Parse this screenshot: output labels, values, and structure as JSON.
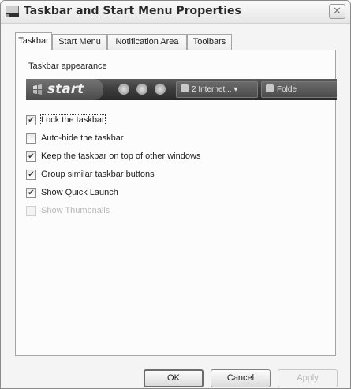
{
  "window": {
    "title": "Taskbar and Start Menu Properties",
    "close_glyph": "✕"
  },
  "tabs": [
    {
      "label": "Taskbar",
      "active": true
    },
    {
      "label": "Start Menu",
      "active": false
    },
    {
      "label": "Notification Area",
      "active": false
    },
    {
      "label": "Toolbars",
      "active": false
    }
  ],
  "taskbar_panel": {
    "group_label": "Taskbar appearance",
    "preview": {
      "start_label": "start",
      "task_buttons": [
        {
          "label": "2 Internet...",
          "icon": "ie-icon",
          "has_dropdown": true
        },
        {
          "label": "Folde",
          "icon": "folder-icon",
          "has_dropdown": false
        }
      ]
    },
    "options": [
      {
        "label": "Lock the taskbar",
        "checked": true,
        "enabled": true
      },
      {
        "label": "Auto-hide the taskbar",
        "checked": false,
        "enabled": true
      },
      {
        "label": "Keep the taskbar on top of other windows",
        "checked": true,
        "enabled": true
      },
      {
        "label": "Group similar taskbar buttons",
        "checked": true,
        "enabled": true
      },
      {
        "label": "Show Quick Launch",
        "checked": true,
        "enabled": true
      },
      {
        "label": "Show Thumbnails",
        "checked": false,
        "enabled": false
      }
    ]
  },
  "buttons": {
    "ok": "OK",
    "cancel": "Cancel",
    "apply": "Apply"
  },
  "colors": {
    "taskbar_dark": "#3e3e3e",
    "disabled_text": "#b8b8b8"
  },
  "check_glyph": "✔"
}
